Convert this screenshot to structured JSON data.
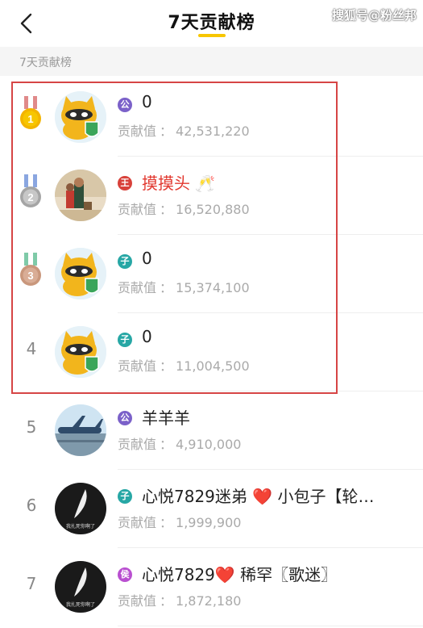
{
  "header": {
    "title": "7天贡献榜",
    "back_icon": "chevron-left-icon",
    "watermark": "搜狐号@粉丝邦",
    "accent_color": "#f7c600"
  },
  "section": {
    "label": "7天贡献榜"
  },
  "score_label": "贡献值",
  "score_sep": "：",
  "rows": [
    {
      "rank": "1",
      "medal": "gold-medal-icon",
      "badge_text": "公",
      "badge_color": "#7b61c9",
      "name": "0",
      "name_suffix": "",
      "name_color": "#222222",
      "score": "42,531,220",
      "avatar": "mascot-avatar"
    },
    {
      "rank": "2",
      "medal": "silver-medal-icon",
      "badge_text": "王",
      "badge_color": "#d8413a",
      "name": "摸摸头",
      "name_suffix": "🥂",
      "name_color": "#e2382f",
      "score": "16,520,880",
      "avatar": "photo-avatar"
    },
    {
      "rank": "3",
      "medal": "bronze-medal-icon",
      "badge_text": "子",
      "badge_color": "#27a7a5",
      "name": "0",
      "name_suffix": "",
      "name_color": "#222222",
      "score": "15,374,100",
      "avatar": "mascot-avatar"
    },
    {
      "rank": "4",
      "medal": "",
      "badge_text": "子",
      "badge_color": "#27a7a5",
      "name": "0",
      "name_suffix": "",
      "name_color": "#222222",
      "score": "11,004,500",
      "avatar": "mascot-avatar"
    },
    {
      "rank": "5",
      "medal": "",
      "badge_text": "公",
      "badge_color": "#7b61c9",
      "name": "羊羊羊",
      "name_suffix": "",
      "name_color": "#222222",
      "score": "4,910,000",
      "avatar": "airplane-avatar"
    },
    {
      "rank": "6",
      "medal": "",
      "badge_text": "子",
      "badge_color": "#27a7a5",
      "name": "心悦7829迷弟 ❤️ 小包子【轮…",
      "name_suffix": "",
      "name_color": "#222222",
      "score": "1,999,900",
      "avatar": "dark-avatar"
    },
    {
      "rank": "7",
      "medal": "",
      "badge_text": "侯",
      "badge_color": "#b94fd0",
      "name": "心悦7829❤️ 稀罕〖歌迷〗",
      "name_suffix": "",
      "name_color": "#222222",
      "score": "1,872,180",
      "avatar": "dark-avatar"
    }
  ],
  "avatar_watermark_text": "我扎死你啊了"
}
